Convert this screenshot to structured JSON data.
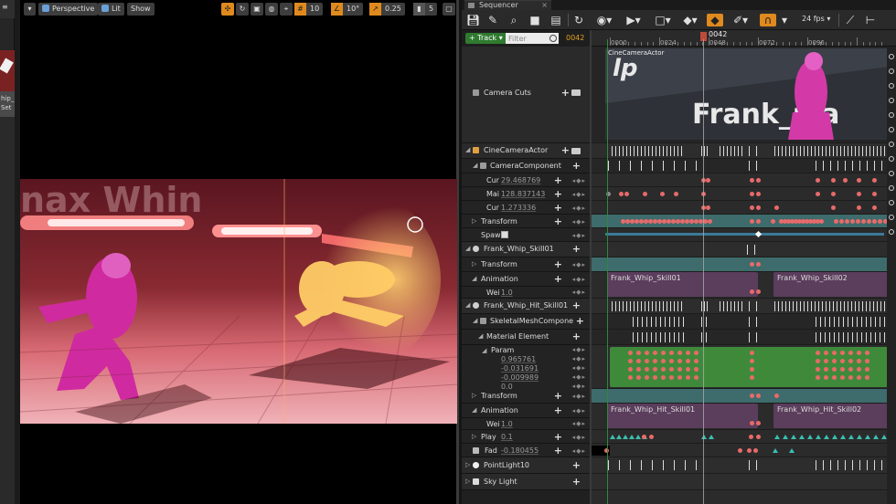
{
  "left_panel": {
    "label_line1": "hip_",
    "label_line2": "Set"
  },
  "viewport": {
    "perspective_label": "Perspective",
    "lit_label": "Lit",
    "show_label": "Show",
    "grid_snap": "10",
    "rotation_snap": "10°",
    "scale_snap": "0.25",
    "camera_speed": "5"
  },
  "sequencer": {
    "tab_title": "Sequencer",
    "fps_label": "24 fps",
    "track_button": "+ Track",
    "filter_placeholder": "Filter",
    "current_frame": "0042",
    "playhead_label": "0042",
    "ruler_labels": [
      "0000",
      "0024",
      "0048",
      "0072",
      "0096"
    ],
    "camera_track_label": "CineCameraActor",
    "camera_shot_text": "Frank_ma"
  },
  "tracks": [
    {
      "id": "camera-cuts",
      "label": "Camera Cuts"
    },
    {
      "id": "cine-camera-actor",
      "label": "CineCameraActor"
    },
    {
      "id": "camera-component",
      "label": "CameraComponent"
    },
    {
      "id": "current-focal-length",
      "label": "Cur",
      "value": "29.468769"
    },
    {
      "id": "manual-focus-distance",
      "label": "Mai",
      "value": "128.837143"
    },
    {
      "id": "current-aperture",
      "label": "Cur",
      "value": "1.273336"
    },
    {
      "id": "camera-transform",
      "label": "Transform"
    },
    {
      "id": "spawned",
      "label": "Spaw"
    },
    {
      "id": "frank-whip-skill01",
      "label": "Frank_Whip_Skill01"
    },
    {
      "id": "skill01-transform",
      "label": "Transform"
    },
    {
      "id": "skill01-animation",
      "label": "Animation"
    },
    {
      "id": "skill01-weight",
      "label": "Wei",
      "value": "1.0"
    },
    {
      "id": "frank-whip-hit-skill01",
      "label": "Frank_Whip_Hit_Skill01"
    },
    {
      "id": "skeletal-mesh-component",
      "label": "SkeletalMeshCompone"
    },
    {
      "id": "material-element",
      "label": "Material Element"
    },
    {
      "id": "param",
      "label": "Param"
    },
    {
      "id": "param-v1",
      "value": "0.965761"
    },
    {
      "id": "param-v2",
      "value": "-0.031691"
    },
    {
      "id": "param-v3",
      "value": "-0.009989"
    },
    {
      "id": "param-v4",
      "value": "0.0"
    },
    {
      "id": "hit-transform",
      "label": "Transform"
    },
    {
      "id": "hit-animation",
      "label": "Animation"
    },
    {
      "id": "hit-weight",
      "label": "Wei",
      "value": "1.0"
    },
    {
      "id": "play-rate",
      "label": "Play",
      "value": "0.1"
    },
    {
      "id": "fade",
      "label": "Fad",
      "value": "-0.180455"
    },
    {
      "id": "point-light",
      "label": "PointLight10"
    },
    {
      "id": "sky-light",
      "label": "Sky Light"
    }
  ],
  "sections": [
    {
      "id": "anim-skill01",
      "label": "Frank_Whip_Skill01"
    },
    {
      "id": "anim-skill02",
      "label": "Frank_Whip_Skill02"
    },
    {
      "id": "anim-hit-skill01",
      "label": "Frank_Whip_Hit_Skill01"
    },
    {
      "id": "anim-hit-skill02",
      "label": "Frank_Whip_Hit_Skill02"
    }
  ],
  "colors": {
    "accent_orange": "#e08a1e",
    "track_green": "#2f7a2f",
    "keyframe_red": "#e86a6a",
    "keyframe_teal": "#3ac0b0",
    "anim_section": "#5b3d5c",
    "transform_section": "#3e6b6b",
    "material_section": "#3f8a3a"
  },
  "icons": {
    "save": "save-icon",
    "browse": "browse-icon",
    "search": "search-icon",
    "camera": "camera-icon",
    "render": "render-movie-icon",
    "refresh": "refresh-icon",
    "eye": "eye-icon",
    "play": "play-icon",
    "key": "key-icon",
    "auto_key": "auto-key-icon",
    "magnet": "magnet-icon",
    "graph": "curve-editor-icon"
  }
}
